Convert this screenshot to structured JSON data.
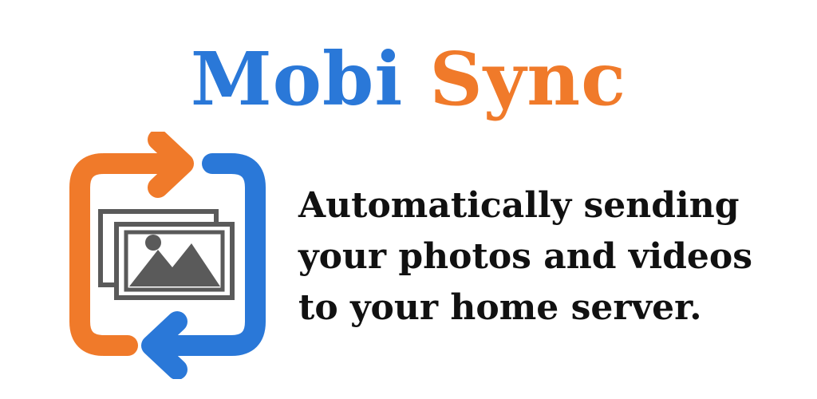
{
  "title": {
    "word1": "Mobi",
    "word2": "Sync"
  },
  "tagline": {
    "line1": "Automatically sending",
    "line2": "your photos and videos",
    "line3": "to your home server."
  },
  "colors": {
    "blue": "#2a78d8",
    "orange": "#f07a2a",
    "gray": "#5a5a5a",
    "text": "#111111"
  },
  "icons": {
    "logo": "sync-photos-icon"
  }
}
